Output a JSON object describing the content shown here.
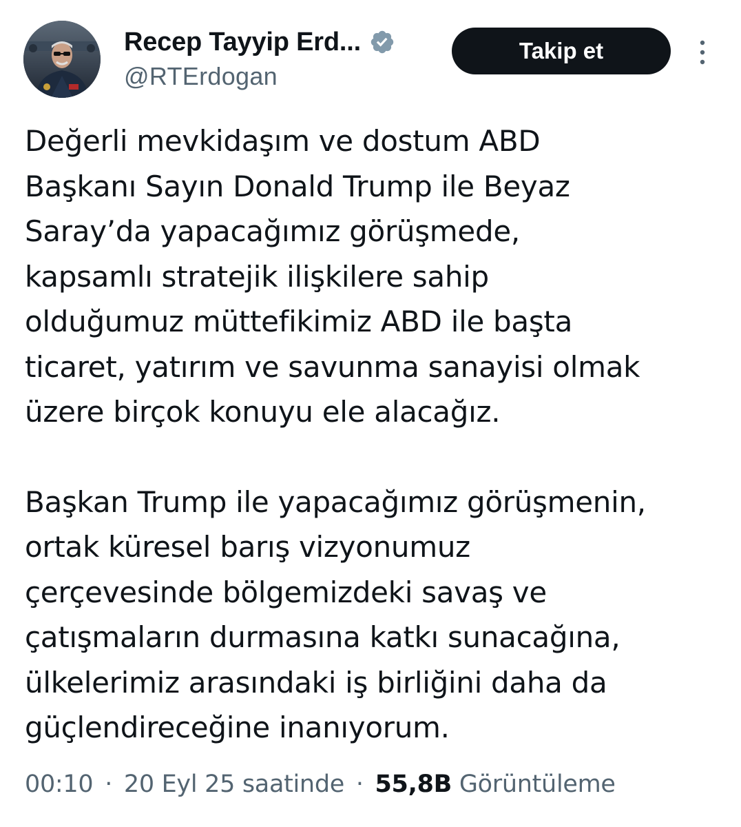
{
  "user": {
    "display_name": "Recep Tayyip Erd...",
    "handle": "@RTErdogan",
    "verified_icon": "verified-badge-icon",
    "avatar_icon": "profile-photo"
  },
  "actions": {
    "follow_label": "Takip et",
    "more_icon": "more-vertical-icon"
  },
  "tweet": {
    "paragraphs": [
      "Değerli mevkidaşım ve dostum ABD\nBaşkanı Sayın Donald Trump ile Beyaz\nSaray’da yapacağımız görüşmede,\nkapsamlı stratejik ilişkilere sahip\nolduğumuz müttefikimiz ABD ile başta\nticaret, yatırım ve savunma sanayisi olmak\nüzere birçok konuyu ele alacağız.",
      "Başkan Trump ile yapacağımız görüşmenin,\nortak küresel barış vizyonumuz\nçerçevesinde bölgemizdeki savaş ve\nçatışmaların durmasına katkı sunacağına,\nülkelerimiz arasındaki iş birliğini daha da\ngüçlendireceğine inanıyorum."
    ]
  },
  "meta": {
    "time": "00:10",
    "separator": "·",
    "date": "20 Eyl 25 saatinde",
    "views_count": "55,8B",
    "views_label": "Görüntüleme"
  },
  "colors": {
    "text_primary": "#0f1419",
    "text_secondary": "#536471",
    "button_bg": "#0f1419",
    "verified_badge": "#829aab"
  }
}
